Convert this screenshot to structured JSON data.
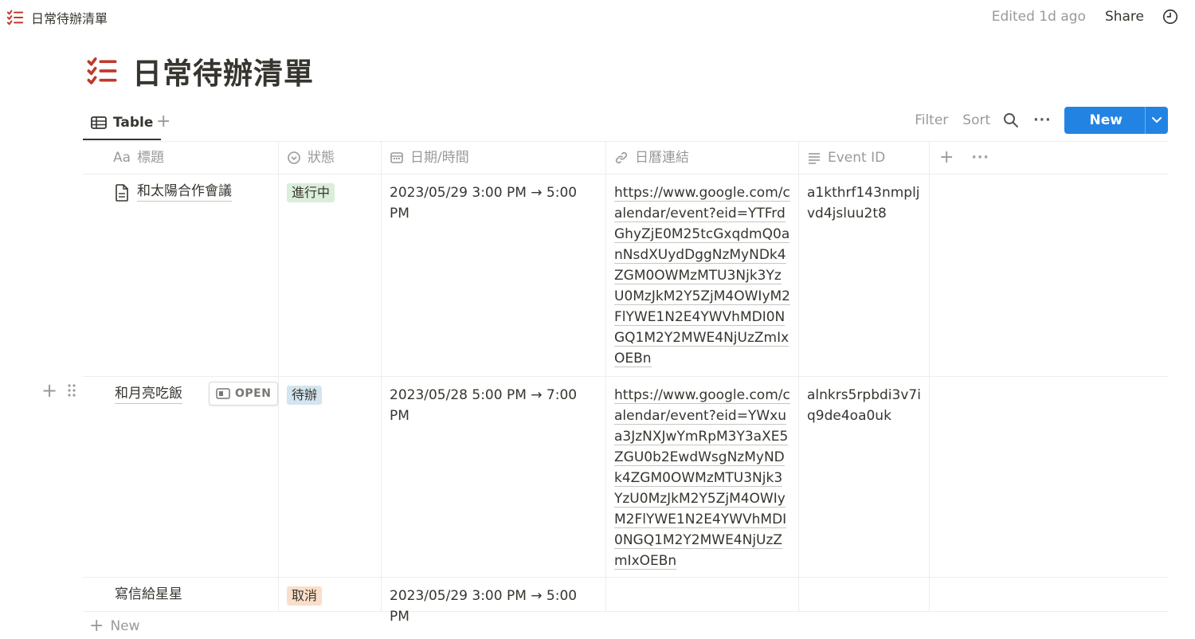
{
  "topbar": {
    "breadcrumb": "日常待辦清單",
    "edited": "Edited 1d ago",
    "share": "Share"
  },
  "page": {
    "title": "日常待辦清單"
  },
  "views": {
    "active_tab": "Table",
    "add": "+"
  },
  "actions": {
    "filter": "Filter",
    "sort": "Sort",
    "more": "···",
    "new": "New"
  },
  "columns": [
    {
      "prefix": "Aa",
      "label": "標題",
      "icon": "text-icon"
    },
    {
      "label": "狀態",
      "icon": "status-icon"
    },
    {
      "label": "日期/時間",
      "icon": "calendar-icon"
    },
    {
      "label": "日曆連結",
      "icon": "link-icon"
    },
    {
      "label": "Event ID",
      "icon": "lines-icon"
    }
  ],
  "header_actions": {
    "add": "+",
    "more": "···"
  },
  "rows": [
    {
      "title": "和太陽合作會議",
      "status": "進行中",
      "status_bg": "#dbeddb",
      "datetime": "2023/05/29 3:00 PM → 5:00 PM",
      "link": "https://www.google.com/calendar/event?eid=YTFrdGhyZjE0M25tcGxqdmQ0anNsdXUydDggNzMyNDk4ZGM0OWMzMTU3Njk3YzU0MzJkM2Y5ZjM4OWIyM2FlYWE1N2E4YWVhMDI0NGQ1M2Y2MWE4NjUzZmIxOEBn",
      "event_id": "a1kthrf143nmpljvd4jsluu2t8"
    },
    {
      "title": "和月亮吃飯",
      "status": "待辦",
      "status_bg": "#d3e5ef",
      "datetime": "2023/05/28 5:00 PM → 7:00 PM",
      "link": "https://www.google.com/calendar/event?eid=YWxua3JzNXJwYmRpM3Y3aXE5ZGU0b2EwdWsgNzMyNDk4ZGM0OWMzMTU3Njk3YzU0MzJkM2Y5ZjM4OWIyM2FlYWE1N2E4YWVhMDI0NGQ1M2Y2MWE4NjUzZmIxOEBn",
      "event_id": "alnkrs5rpbdi3v7iq9de4oa0uk",
      "open": "OPEN"
    },
    {
      "title": "寫信給星星",
      "status": "取消",
      "status_bg": "#fadec9",
      "datetime": "2023/05/29 3:00 PM → 5:00 PM",
      "link": "",
      "event_id": ""
    }
  ],
  "new_row": "New"
}
